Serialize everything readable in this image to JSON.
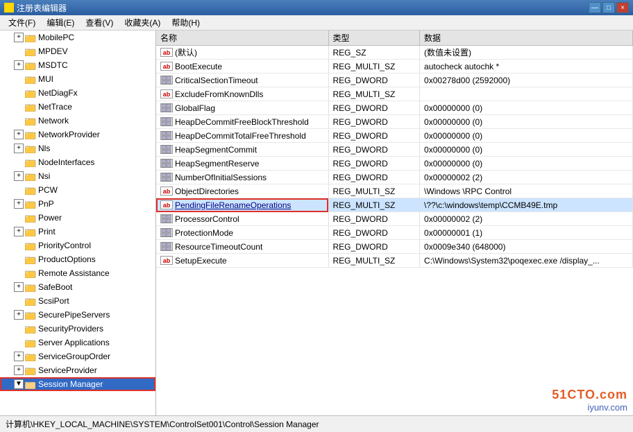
{
  "titleBar": {
    "title": "注册表编辑器",
    "buttons": [
      "—",
      "□",
      "×"
    ]
  },
  "menuBar": {
    "items": [
      "文件(F)",
      "编辑(E)",
      "查看(V)",
      "收藏夹(A)",
      "帮助(H)"
    ]
  },
  "tree": {
    "items": [
      {
        "id": "mobilepc",
        "label": "MobilePC",
        "indent": 2,
        "hasExpand": true,
        "expandChar": "+",
        "selected": false,
        "highlighted": false
      },
      {
        "id": "mpdev",
        "label": "MPDEV",
        "indent": 2,
        "hasExpand": false,
        "selected": false,
        "highlighted": false
      },
      {
        "id": "msdtc",
        "label": "MSDTC",
        "indent": 2,
        "hasExpand": true,
        "expandChar": "+",
        "selected": false,
        "highlighted": false
      },
      {
        "id": "mui",
        "label": "MUI",
        "indent": 2,
        "hasExpand": false,
        "selected": false,
        "highlighted": false
      },
      {
        "id": "netdiagfx",
        "label": "NetDiagFx",
        "indent": 2,
        "hasExpand": false,
        "selected": false,
        "highlighted": false
      },
      {
        "id": "nettrace",
        "label": "NetTrace",
        "indent": 2,
        "hasExpand": false,
        "selected": false,
        "highlighted": false
      },
      {
        "id": "network",
        "label": "Network",
        "indent": 2,
        "hasExpand": false,
        "selected": false,
        "highlighted": false
      },
      {
        "id": "networkprovider",
        "label": "NetworkProvider",
        "indent": 2,
        "hasExpand": true,
        "expandChar": "+",
        "selected": false,
        "highlighted": false
      },
      {
        "id": "nls",
        "label": "Nls",
        "indent": 2,
        "hasExpand": true,
        "expandChar": "+",
        "selected": false,
        "highlighted": false
      },
      {
        "id": "nodeinterfaces",
        "label": "NodeInterfaces",
        "indent": 2,
        "hasExpand": false,
        "selected": false,
        "highlighted": false
      },
      {
        "id": "nsi",
        "label": "Nsi",
        "indent": 2,
        "hasExpand": true,
        "expandChar": "+",
        "selected": false,
        "highlighted": false
      },
      {
        "id": "pcw",
        "label": "PCW",
        "indent": 2,
        "hasExpand": false,
        "selected": false,
        "highlighted": false
      },
      {
        "id": "pnp",
        "label": "PnP",
        "indent": 2,
        "hasExpand": true,
        "expandChar": "+",
        "selected": false,
        "highlighted": false
      },
      {
        "id": "power",
        "label": "Power",
        "indent": 2,
        "hasExpand": false,
        "selected": false,
        "highlighted": false
      },
      {
        "id": "print",
        "label": "Print",
        "indent": 2,
        "hasExpand": true,
        "expandChar": "+",
        "selected": false,
        "highlighted": false
      },
      {
        "id": "prioritycontrol",
        "label": "PriorityControl",
        "indent": 2,
        "hasExpand": false,
        "selected": false,
        "highlighted": false
      },
      {
        "id": "productoptions",
        "label": "ProductOptions",
        "indent": 2,
        "hasExpand": false,
        "selected": false,
        "highlighted": false
      },
      {
        "id": "remoteassistance",
        "label": "Remote Assistance",
        "indent": 2,
        "hasExpand": false,
        "selected": false,
        "highlighted": false
      },
      {
        "id": "safeboot",
        "label": "SafeBoot",
        "indent": 2,
        "hasExpand": true,
        "expandChar": "+",
        "selected": false,
        "highlighted": false
      },
      {
        "id": "scsiport",
        "label": "ScsiPort",
        "indent": 2,
        "hasExpand": false,
        "selected": false,
        "highlighted": false
      },
      {
        "id": "securepipeservers",
        "label": "SecurePipeServers",
        "indent": 2,
        "hasExpand": true,
        "expandChar": "+",
        "selected": false,
        "highlighted": false
      },
      {
        "id": "securityproviders",
        "label": "SecurityProviders",
        "indent": 2,
        "hasExpand": false,
        "selected": false,
        "highlighted": false
      },
      {
        "id": "serverapplications",
        "label": "Server Applications",
        "indent": 2,
        "hasExpand": false,
        "selected": false,
        "highlighted": false
      },
      {
        "id": "servicegrouporder",
        "label": "ServiceGroupOrder",
        "indent": 2,
        "hasExpand": true,
        "expandChar": "+",
        "selected": false,
        "highlighted": false
      },
      {
        "id": "serviceprovider",
        "label": "ServiceProvider",
        "indent": 2,
        "hasExpand": true,
        "expandChar": "+",
        "selected": false,
        "highlighted": false
      },
      {
        "id": "sessionmanager",
        "label": "Session Manager",
        "indent": 2,
        "hasExpand": true,
        "expandChar": "▼",
        "selected": true,
        "highlighted": true
      }
    ]
  },
  "columns": [
    "名称",
    "类型",
    "数据"
  ],
  "values": [
    {
      "id": "default",
      "icon": "ab",
      "name": "(默认)",
      "type": "REG_SZ",
      "data": "(数值未设置)",
      "selected": false,
      "highlighted": false
    },
    {
      "id": "bootexecute",
      "icon": "ab",
      "name": "BootExecute",
      "type": "REG_MULTI_SZ",
      "data": "autocheck autochk *",
      "selected": false,
      "highlighted": false
    },
    {
      "id": "criticalsectiontimeout",
      "icon": "dword",
      "name": "CriticalSectionTimeout",
      "type": "REG_DWORD",
      "data": "0x00278d00 (2592000)",
      "selected": false,
      "highlighted": false
    },
    {
      "id": "excludefromknowndlls",
      "icon": "ab",
      "name": "ExcludeFromKnownDlls",
      "type": "REG_MULTI_SZ",
      "data": "",
      "selected": false,
      "highlighted": false
    },
    {
      "id": "globalflag",
      "icon": "dword",
      "name": "GlobalFlag",
      "type": "REG_DWORD",
      "data": "0x00000000 (0)",
      "selected": false,
      "highlighted": false
    },
    {
      "id": "heapdecommitfreeblockthreshold",
      "icon": "dword",
      "name": "HeapDeCommitFreeBlockThreshold",
      "type": "REG_DWORD",
      "data": "0x00000000 (0)",
      "selected": false,
      "highlighted": false
    },
    {
      "id": "heapdecommittotalfreethreshold",
      "icon": "dword",
      "name": "HeapDeCommitTotalFreeThreshold",
      "type": "REG_DWORD",
      "data": "0x00000000 (0)",
      "selected": false,
      "highlighted": false
    },
    {
      "id": "heapsegmentcommit",
      "icon": "dword",
      "name": "HeapSegmentCommit",
      "type": "REG_DWORD",
      "data": "0x00000000 (0)",
      "selected": false,
      "highlighted": false
    },
    {
      "id": "heapsegmentreserve",
      "icon": "dword",
      "name": "HeapSegmentReserve",
      "type": "REG_DWORD",
      "data": "0x00000000 (0)",
      "selected": false,
      "highlighted": false
    },
    {
      "id": "numberofinitialsessions",
      "icon": "dword",
      "name": "NumberOfInitialSessions",
      "type": "REG_DWORD",
      "data": "0x00000002 (2)",
      "selected": false,
      "highlighted": false
    },
    {
      "id": "objectdirectories",
      "icon": "ab",
      "name": "ObjectDirectories",
      "type": "REG_MULTI_SZ",
      "data": "\\Windows \\RPC Control",
      "selected": false,
      "highlighted": false
    },
    {
      "id": "pendingfilerenameooperations",
      "icon": "ab",
      "name": "PendingFileRenameOperations",
      "type": "REG_MULTI_SZ",
      "data": "\\??\\c:\\windows\\temp\\CCMB49E.tmp",
      "selected": false,
      "highlighted": true
    },
    {
      "id": "processorcontrol",
      "icon": "dword",
      "name": "ProcessorControl",
      "type": "REG_DWORD",
      "data": "0x00000002 (2)",
      "selected": false,
      "highlighted": false
    },
    {
      "id": "protectionmode",
      "icon": "dword",
      "name": "ProtectionMode",
      "type": "REG_DWORD",
      "data": "0x00000001 (1)",
      "selected": false,
      "highlighted": false
    },
    {
      "id": "resourcetimeoutcount",
      "icon": "dword",
      "name": "ResourceTimeoutCount",
      "type": "REG_DWORD",
      "data": "0x0009e340 (648000)",
      "selected": false,
      "highlighted": false
    },
    {
      "id": "setupexecute",
      "icon": "ab",
      "name": "SetupExecute",
      "type": "REG_MULTI_SZ",
      "data": "C:\\Windows\\System32\\poqexec.exe /display_...",
      "selected": false,
      "highlighted": false
    }
  ],
  "statusBar": {
    "text": "计算机\\HKEY_LOCAL_MACHINE\\SYSTEM\\ControlSet001\\Control\\Session Manager"
  },
  "watermark": {
    "line1": "51CTO.com",
    "line2": "iyunv.com"
  }
}
